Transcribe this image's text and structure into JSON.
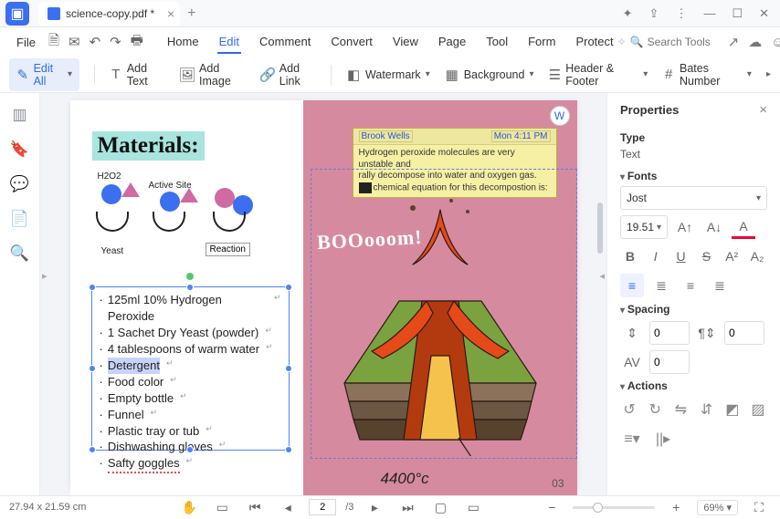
{
  "titlebar": {
    "tab_title": "science-copy.pdf *"
  },
  "menubar": {
    "file": "File",
    "items": [
      "Home",
      "Edit",
      "Comment",
      "Convert",
      "View",
      "Page",
      "Tool",
      "Form",
      "Protect"
    ],
    "active_index": 1,
    "search_placeholder": "Search Tools"
  },
  "toolbar": {
    "edit_all": "Edit All",
    "add_text": "Add Text",
    "add_image": "Add Image",
    "add_link": "Add Link",
    "watermark": "Watermark",
    "background": "Background",
    "header_footer": "Header & Footer",
    "bates": "Bates Number"
  },
  "document": {
    "materials_heading": "Materials:",
    "sketch_labels": {
      "h2o2": "H2O2",
      "active_site": "Active Site",
      "yeast": "Yeast",
      "reaction": "Reaction"
    },
    "list": [
      "125ml 10% Hydrogen Peroxide",
      "1 Sachet Dry Yeast (powder)",
      "4 tablespoons of warm water",
      "Detergent",
      "Food color",
      "Empty bottle",
      "Funnel",
      "Plastic tray or tub",
      "Dishwashing gloves",
      "Safty goggles"
    ],
    "selected_index": 3,
    "misspelled_indices": [
      9
    ],
    "note": {
      "author": "Brook Wells",
      "timestamp": "Mon 4:11 PM",
      "body_l1": "Hydrogen peroxide molecules are very unstable and",
      "body_l2": "rally decompose into water and oxygen gas.",
      "body_l3": "chemical equation for this decompostion is:"
    },
    "boom": "BOOooom!",
    "temperature": "4400°c",
    "pagenum": "03"
  },
  "properties": {
    "title": "Properties",
    "type_label": "Type",
    "type_value": "Text",
    "fonts_label": "Fonts",
    "font_family": "Jost",
    "font_size": "19.51",
    "spacing_label": "Spacing",
    "line_sp": "0",
    "para_sp": "0",
    "char_sp": "0",
    "actions_label": "Actions"
  },
  "status": {
    "dimensions": "27.94 x 21.59 cm",
    "page_current": "2",
    "page_total": "/3",
    "zoom": "69%"
  }
}
